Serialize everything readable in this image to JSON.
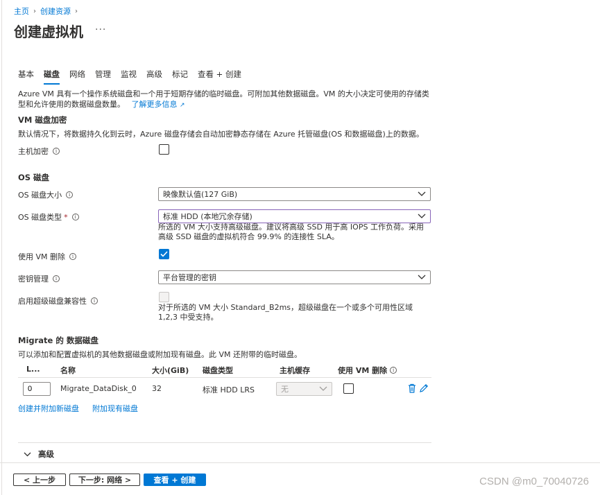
{
  "breadcrumb": {
    "home": "主页",
    "create": "创建资源"
  },
  "page": {
    "title": "创建虚拟机",
    "more": "···"
  },
  "tabs": [
    {
      "label": "基本",
      "active": false
    },
    {
      "label": "磁盘",
      "active": true
    },
    {
      "label": "网络",
      "active": false
    },
    {
      "label": "管理",
      "active": false
    },
    {
      "label": "监视",
      "active": false
    },
    {
      "label": "高级",
      "active": false
    },
    {
      "label": "标记",
      "active": false
    },
    {
      "label": "查看 + 创建",
      "active": false
    }
  ],
  "intro": {
    "text": "Azure VM 具有一个操作系统磁盘和一个用于短期存储的临时磁盘。可附加其他数据磁盘。VM 的大小决定可使用的存储类型和允许使用的数据磁盘数量。",
    "link": "了解更多信息"
  },
  "encryption": {
    "heading": "VM 磁盘加密",
    "description": "默认情况下，将数据持久化到云时，Azure 磁盘存储会自动加密静态存储在 Azure 托管磁盘(OS 和数据磁盘)上的数据。",
    "host_label": "主机加密",
    "host_checked": false
  },
  "os_disk": {
    "heading": "OS 磁盘",
    "size_label": "OS 磁盘大小",
    "size_value": "映像默认值(127 GiB)",
    "type_label": "OS 磁盘类型",
    "type_required": "*",
    "type_value": "标准 HDD (本地冗余存储)",
    "type_hint": "所选的 VM 大小支持高级磁盘。建议将高级 SSD 用于高 IOPS 工作负荷。采用高级 SSD 磁盘的虚拟机符合 99.9% 的连接性 SLA。",
    "delete_label": "使用 VM 删除",
    "delete_checked": true,
    "key_label": "密钥管理",
    "key_value": "平台管理的密钥",
    "ultra_label": "启用超级磁盘兼容性",
    "ultra_checked": false,
    "ultra_hint": "对于所选的 VM 大小 Standard_B2ms，超级磁盘在一个或多个可用性区域 1,2,3 中受支持。"
  },
  "data_disks": {
    "heading": "Migrate 的 数据磁盘",
    "description": "可以添加和配置虚拟机的其他数据磁盘或附加现有磁盘。此 VM 还附带的临时磁盘。",
    "columns": {
      "lun": "L...",
      "name": "名称",
      "size": "大小(GiB)",
      "type": "磁盘类型",
      "cache": "主机缓存",
      "delete": "使用 VM 删除"
    },
    "rows": [
      {
        "lun": "0",
        "name": "Migrate_DataDisk_0",
        "size": "32",
        "type": "标准 HDD LRS",
        "cache": "无",
        "delete_checked": false
      }
    ],
    "create_link": "创建并附加新磁盘",
    "attach_link": "附加现有磁盘"
  },
  "advanced": {
    "label": "高级"
  },
  "footer": {
    "prev": "< 上一步",
    "next": "下一步: 网络 >",
    "review": "查看 + 创建"
  },
  "watermark": "CSDN @m0_70040726",
  "colors": {
    "accent": "#0078d4",
    "focus_border": "#8764b8",
    "required": "#a4262c"
  },
  "icons": [
    "chevron-right-icon",
    "info-icon",
    "chevron-down-icon",
    "external-link-icon",
    "checkmark-icon",
    "delete-icon",
    "edit-icon"
  ]
}
